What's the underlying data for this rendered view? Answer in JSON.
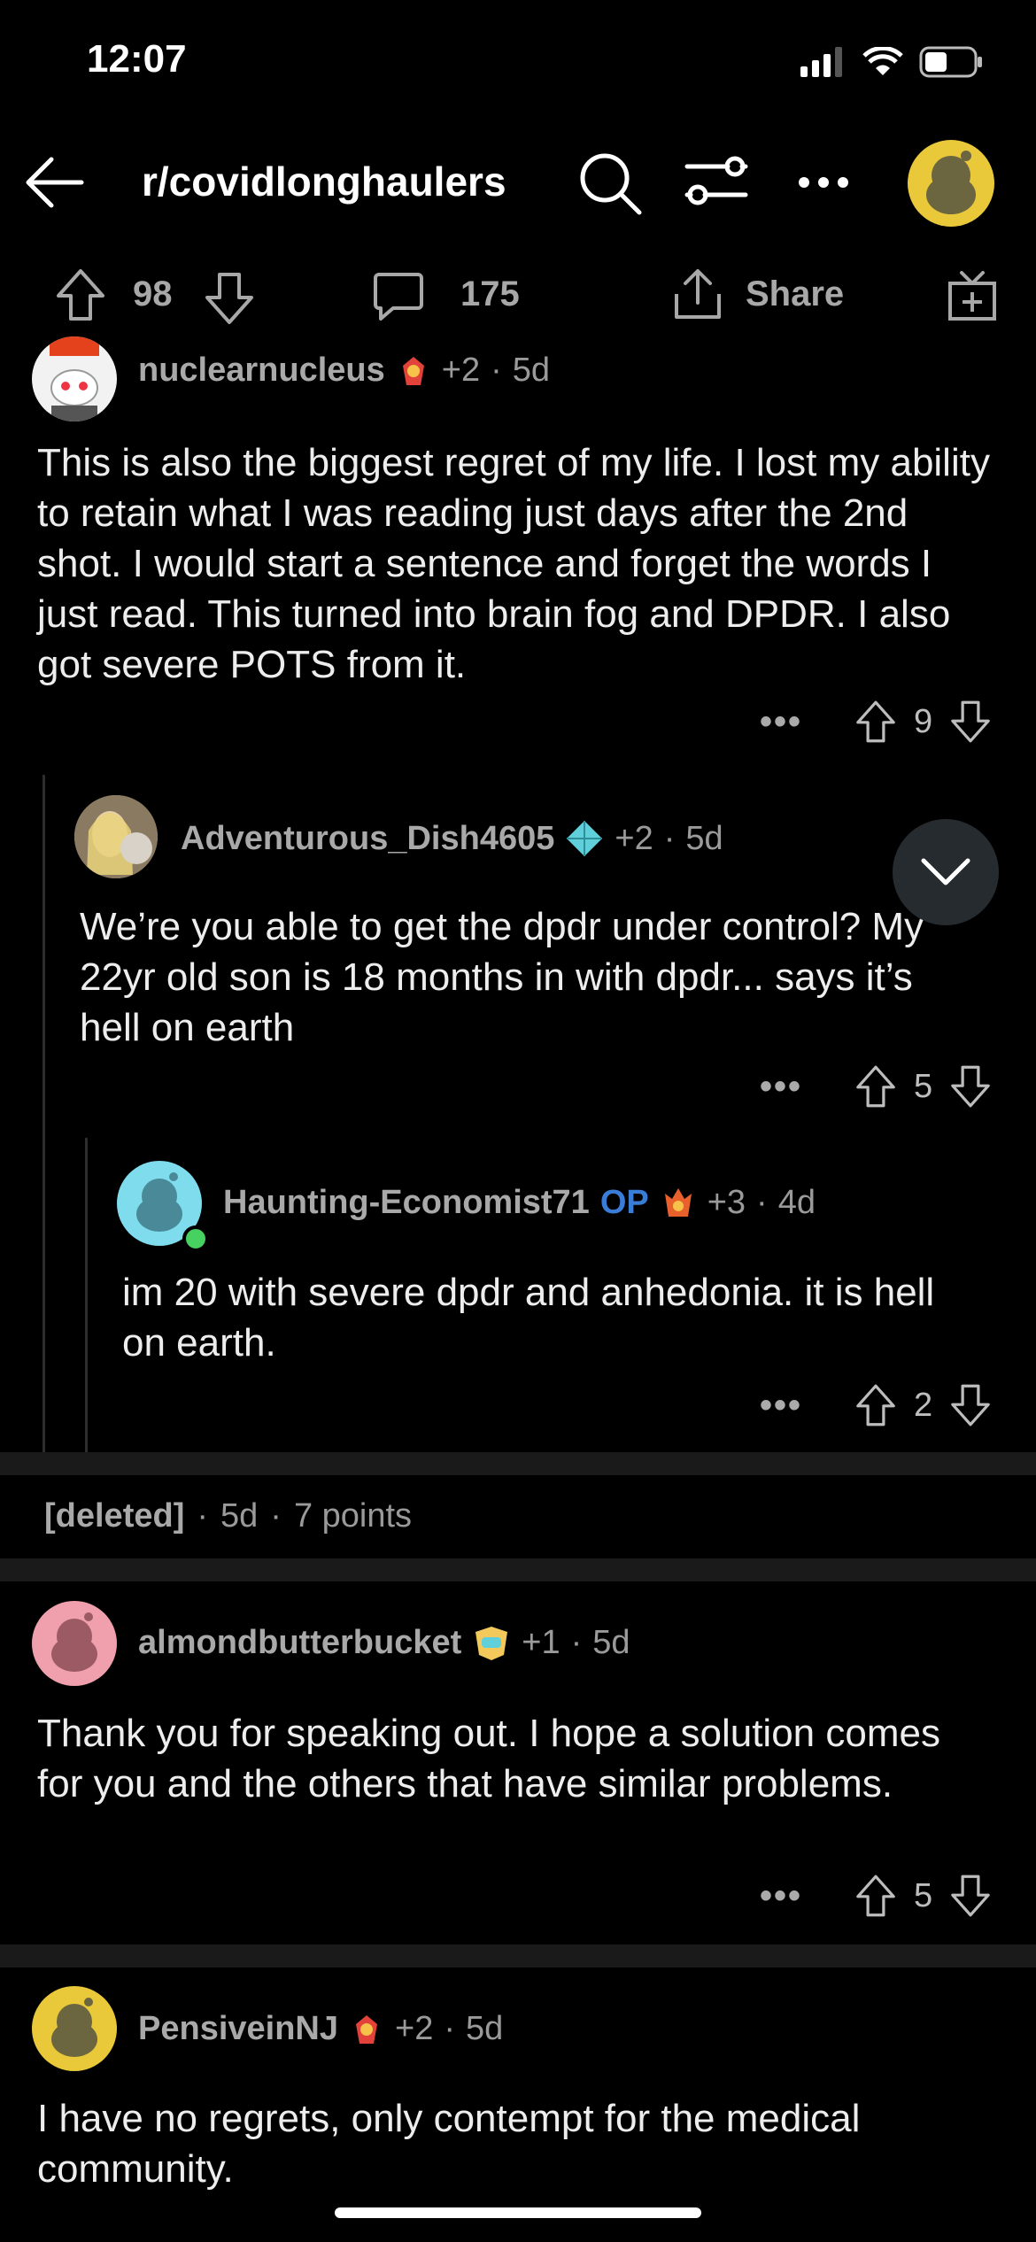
{
  "status_bar": {
    "time": "12:07"
  },
  "nav": {
    "subreddit": "r/covidlonghaulers"
  },
  "post_actions": {
    "upvotes": "98",
    "comments": "175",
    "share_label": "Share"
  },
  "comments": [
    {
      "author": "nuclearnucleus",
      "karma": "+2",
      "age": "5d",
      "text": "This is also the biggest regret of my life. I lost my ability to retain what I was reading just days after the 2nd shot. I would start a sentence and forget the words I just read. This turned into brain fog and DPDR. I also got severe POTS from it.",
      "votes": "9"
    },
    {
      "author": "Adventurous_Dish4605",
      "karma": "+2",
      "age": "5d",
      "text": "We’re you able to get the dpdr under control? My 22yr old son is 18 months in with dpdr... says it’s hell on earth",
      "votes": "5"
    },
    {
      "author": "Haunting-Economist71",
      "op_label": "OP",
      "karma": "+3",
      "age": "4d",
      "text": "im 20 with severe dpdr and anhedonia. it is hell on earth.",
      "votes": "2"
    },
    {
      "deleted_label": "[deleted]",
      "age": "5d",
      "points": "7 points"
    },
    {
      "author": "almondbutterbucket",
      "karma": "+1",
      "age": "5d",
      "text": "Thank you for speaking out. I hope a solution comes for you and the others that have similar problems.",
      "votes": "5"
    },
    {
      "author": "PensiveinNJ",
      "karma": "+2",
      "age": "5d",
      "text": "I have no regrets, only contempt for the medical community."
    }
  ],
  "colors": {
    "background": "#000000",
    "op_accent": "#3a7dd6",
    "divider": "#1a1a1b"
  }
}
